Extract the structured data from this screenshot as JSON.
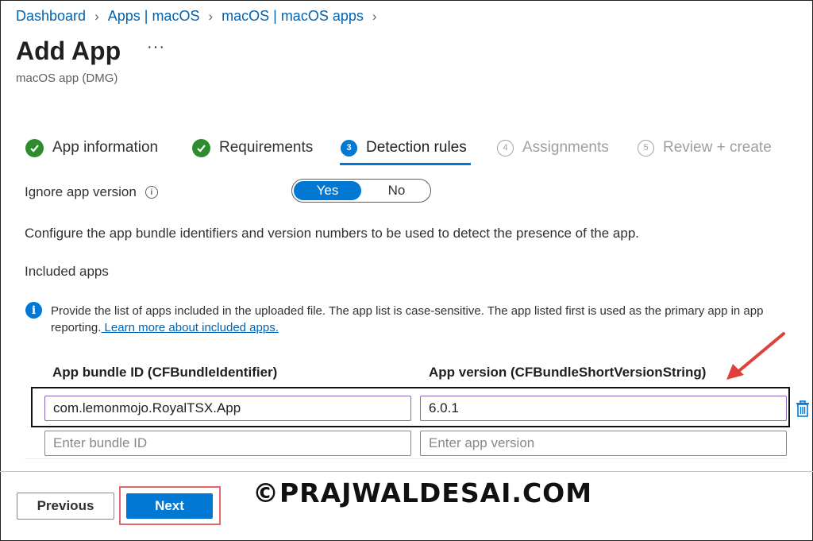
{
  "breadcrumb": [
    "Dashboard",
    "Apps | macOS",
    "macOS | macOS apps"
  ],
  "page": {
    "title": "Add App",
    "more": "···",
    "subtitle": "macOS app (DMG)"
  },
  "steps": [
    {
      "label": "App information",
      "state": "done"
    },
    {
      "label": "Requirements",
      "state": "done"
    },
    {
      "number": "3",
      "label": "Detection rules",
      "state": "active"
    },
    {
      "number": "4",
      "label": "Assignments",
      "state": "idle"
    },
    {
      "number": "5",
      "label": "Review + create",
      "state": "idle"
    }
  ],
  "ignore_version": {
    "label": "Ignore app version",
    "info": "i",
    "options": [
      "Yes",
      "No"
    ],
    "selected": "Yes"
  },
  "description": "Configure the app bundle identifiers and version numbers to be used to detect the presence of the app.",
  "included_apps": {
    "heading": "Included apps",
    "info_icon": "i",
    "info_text": "Provide the list of apps included in the uploaded file. The app list is case-sensitive. The app listed first is used as the primary app in app reporting.",
    "info_link": " Learn more about included apps."
  },
  "table": {
    "columns": [
      "App bundle ID (CFBundleIdentifier)",
      "App version (CFBundleShortVersionString)"
    ],
    "rows": [
      {
        "bundle_id": "com.lemonmojo.RoyalTSX.App",
        "version": "6.0.1"
      }
    ],
    "new_row": {
      "bundle_placeholder": "Enter bundle ID",
      "version_placeholder": "Enter app version"
    }
  },
  "footer": {
    "previous": "Previous",
    "next": "Next"
  },
  "watermark": "©PRAJWALDESAI.COM",
  "colors": {
    "accent": "#0078d4",
    "success": "#2e8b2e",
    "highlight": "#e06a6a",
    "annotation_arrow": "#e0403a"
  },
  "icons": [
    "check-icon",
    "info-icon",
    "trash-icon",
    "arrow-annotation-icon"
  ]
}
